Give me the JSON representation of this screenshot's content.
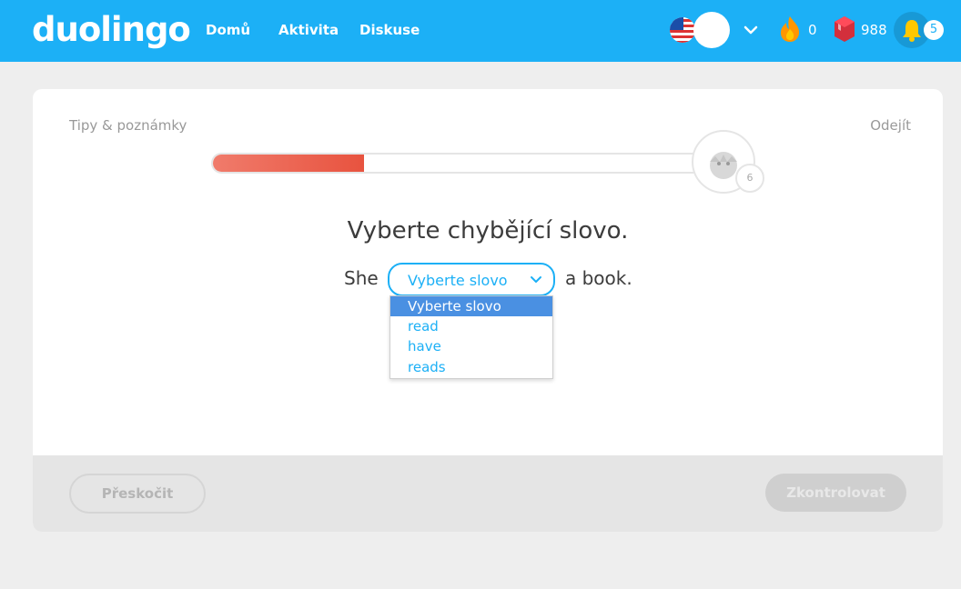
{
  "nav": {
    "logo": "duolingo",
    "links": [
      "Domů",
      "Aktivita",
      "Diskuse"
    ],
    "streak": "0",
    "gems": "988",
    "notifications": "5",
    "icons": {
      "flag": "us-flag-icon",
      "chevron": "chevron-down-icon",
      "streak": "flame-icon",
      "gems": "gem-icon",
      "notifications": "bell-icon"
    }
  },
  "lesson": {
    "tips": "Tipy & poznámky",
    "quit": "Odejít",
    "progress": 0.31,
    "checkpoint_count": "6",
    "prompt": "Vyberte chybějící slovo.",
    "sentence_before": "She",
    "sentence_after": "a book.",
    "select_value": "Vyberte slovo",
    "options": [
      "Vyberte slovo",
      "read",
      "have",
      "reads"
    ],
    "selected_option_index": 0
  },
  "footer": {
    "skip": "Přeskočit",
    "check": "Zkontrolovat"
  },
  "colors": {
    "brand_blue": "#1cb0f6",
    "progress_red": "#e8533f",
    "option_highlight": "#4a90e2",
    "background": "#eeeeee"
  }
}
